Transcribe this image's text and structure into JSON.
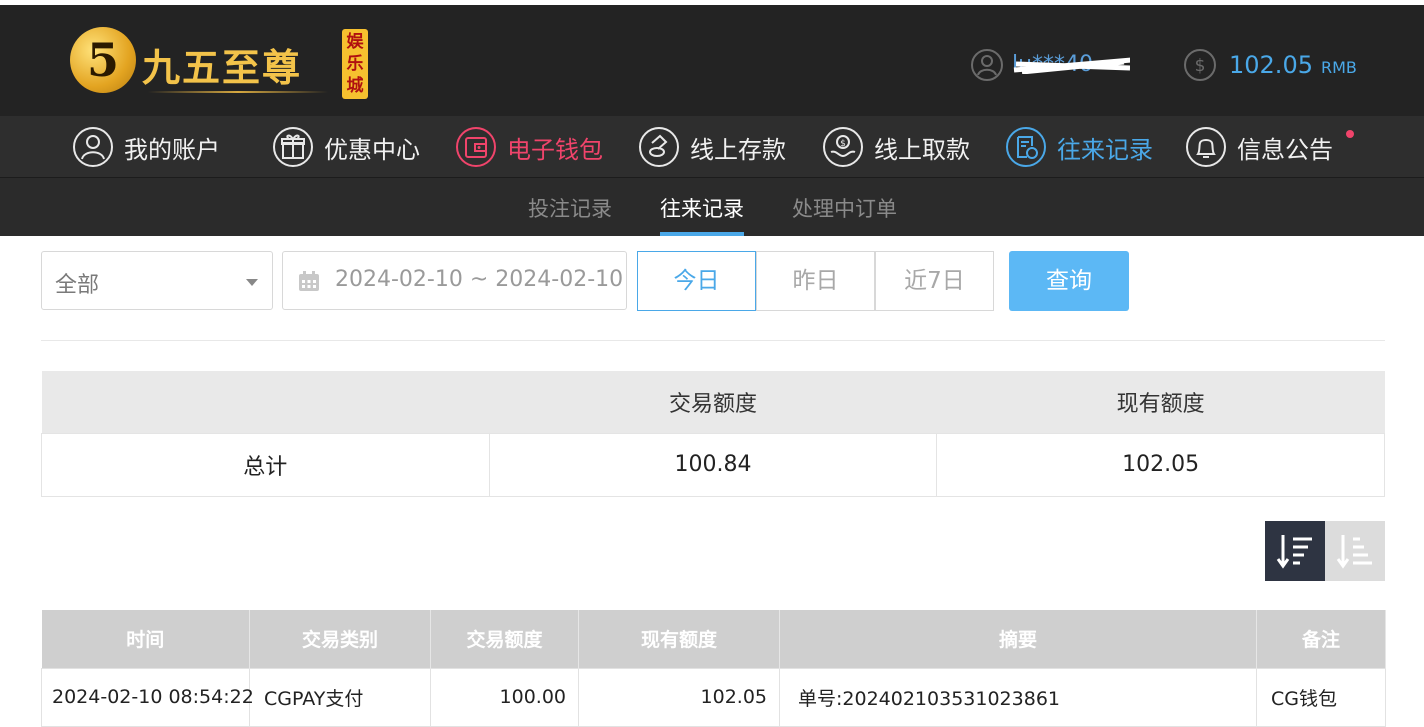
{
  "brand": {
    "logo_mark": "5",
    "name": "九五至尊",
    "badge": "娱乐城"
  },
  "user": {
    "username": "lu***40",
    "icon": "user-icon"
  },
  "balance": {
    "amount": "102.05",
    "currency": "RMB",
    "icon": "dollar-icon"
  },
  "main_nav": [
    {
      "label": "我的账户",
      "icon": "user-icon"
    },
    {
      "label": "优惠中心",
      "icon": "gift-icon"
    },
    {
      "label": "电子钱包",
      "icon": "wallet-icon"
    },
    {
      "label": "线上存款",
      "icon": "deposit-icon"
    },
    {
      "label": "线上取款",
      "icon": "withdraw-icon"
    },
    {
      "label": "往来记录",
      "icon": "records-icon"
    },
    {
      "label": "信息公告",
      "icon": "bell-icon"
    }
  ],
  "sub_nav": [
    {
      "label": "投注记录"
    },
    {
      "label": "往来记录"
    },
    {
      "label": "处理中订单"
    }
  ],
  "filter": {
    "type_selected": "全部",
    "date_range": "2024-02-10 ~ 2024-02-10",
    "quick": [
      "今日",
      "昨日",
      "近7日"
    ],
    "search_label": "查询"
  },
  "summary": {
    "headers": [
      "",
      "交易额度",
      "现有额度"
    ],
    "row": [
      "总计",
      "100.84",
      "102.05"
    ]
  },
  "records": {
    "headers": [
      "时间",
      "交易类别",
      "交易额度",
      "现有额度",
      "摘要",
      "备注"
    ],
    "rows": [
      [
        "2024-02-10 08:54:22",
        "CGPAY支付",
        "100.00",
        "102.05",
        "单号:20240210353102386​1",
        "CG钱包"
      ]
    ]
  },
  "colors": {
    "accent": "#4aa8e8",
    "highlight": "#f0446b",
    "header_bg": "#232323"
  }
}
